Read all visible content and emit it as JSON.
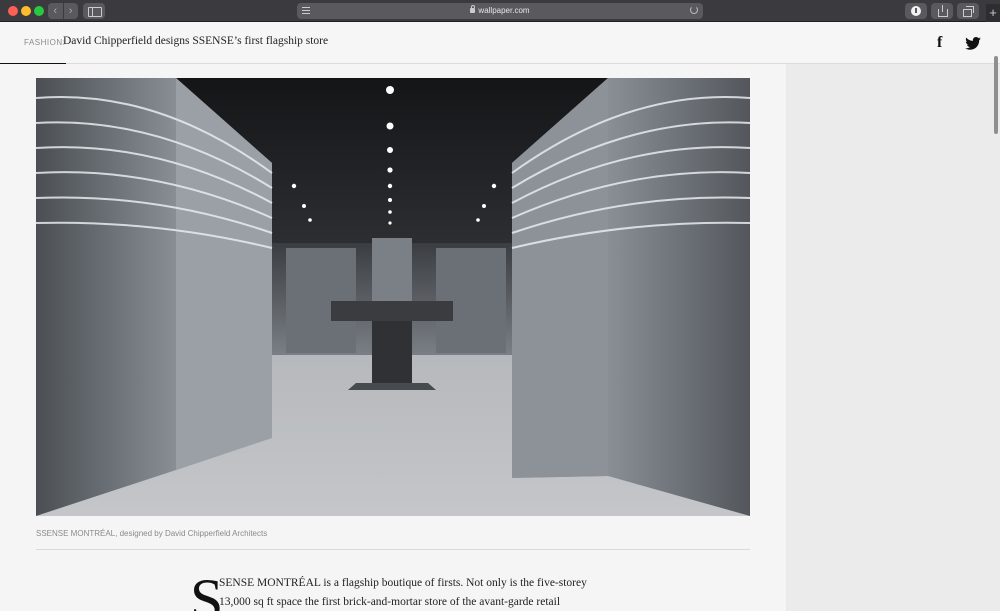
{
  "browser": {
    "url": "wallpaper.com",
    "new_tab_glyph": "+"
  },
  "header": {
    "category": "FASHION:",
    "title": "David Chipperfield designs SSENSE’s first flagship store",
    "icons": [
      "facebook-icon",
      "twitter-icon"
    ],
    "reading_progress": 0.066
  },
  "article": {
    "caption": "SSENSE MONTRÉAL, designed by David Chipperfield Architects",
    "dropcap": "S",
    "body_lines": [
      "SENSE MONTRÉAL is a flagship boutique of firsts. Not only is the five-storey",
      "13,000 sq ft space the first brick-and-mortar store of the avant-garde retail"
    ]
  },
  "colors": {
    "chrome": "#3b3a3f",
    "page_bg": "#f5f5f5",
    "sidebar_bg": "#ebebeb",
    "text": "#222222",
    "muted": "#8a8a8a"
  }
}
